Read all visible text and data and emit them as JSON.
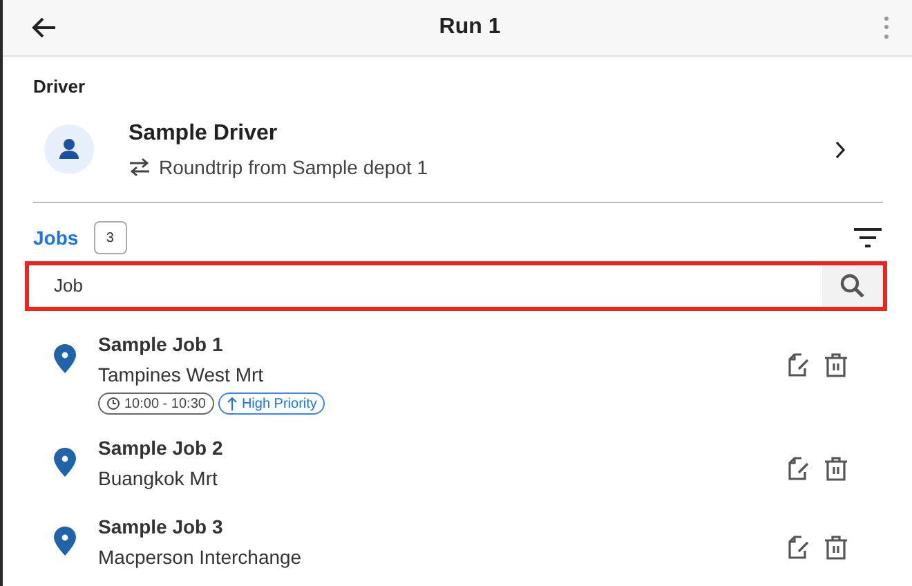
{
  "header": {
    "title": "Run 1"
  },
  "driver": {
    "section_label": "Driver",
    "name": "Sample Driver",
    "route": "Roundtrip from Sample depot 1"
  },
  "jobs": {
    "label": "Jobs",
    "count": "3",
    "search": {
      "value": "Job"
    },
    "items": [
      {
        "title": "Sample Job 1",
        "address": "Tampines West Mrt",
        "tags": [
          {
            "kind": "time",
            "text": "10:00 - 10:30"
          },
          {
            "kind": "priority",
            "text": "High Priority"
          }
        ]
      },
      {
        "title": "Sample Job 2",
        "address": "Buangkok Mrt"
      },
      {
        "title": "Sample Job 3",
        "address": "Macperson Interchange"
      }
    ]
  }
}
